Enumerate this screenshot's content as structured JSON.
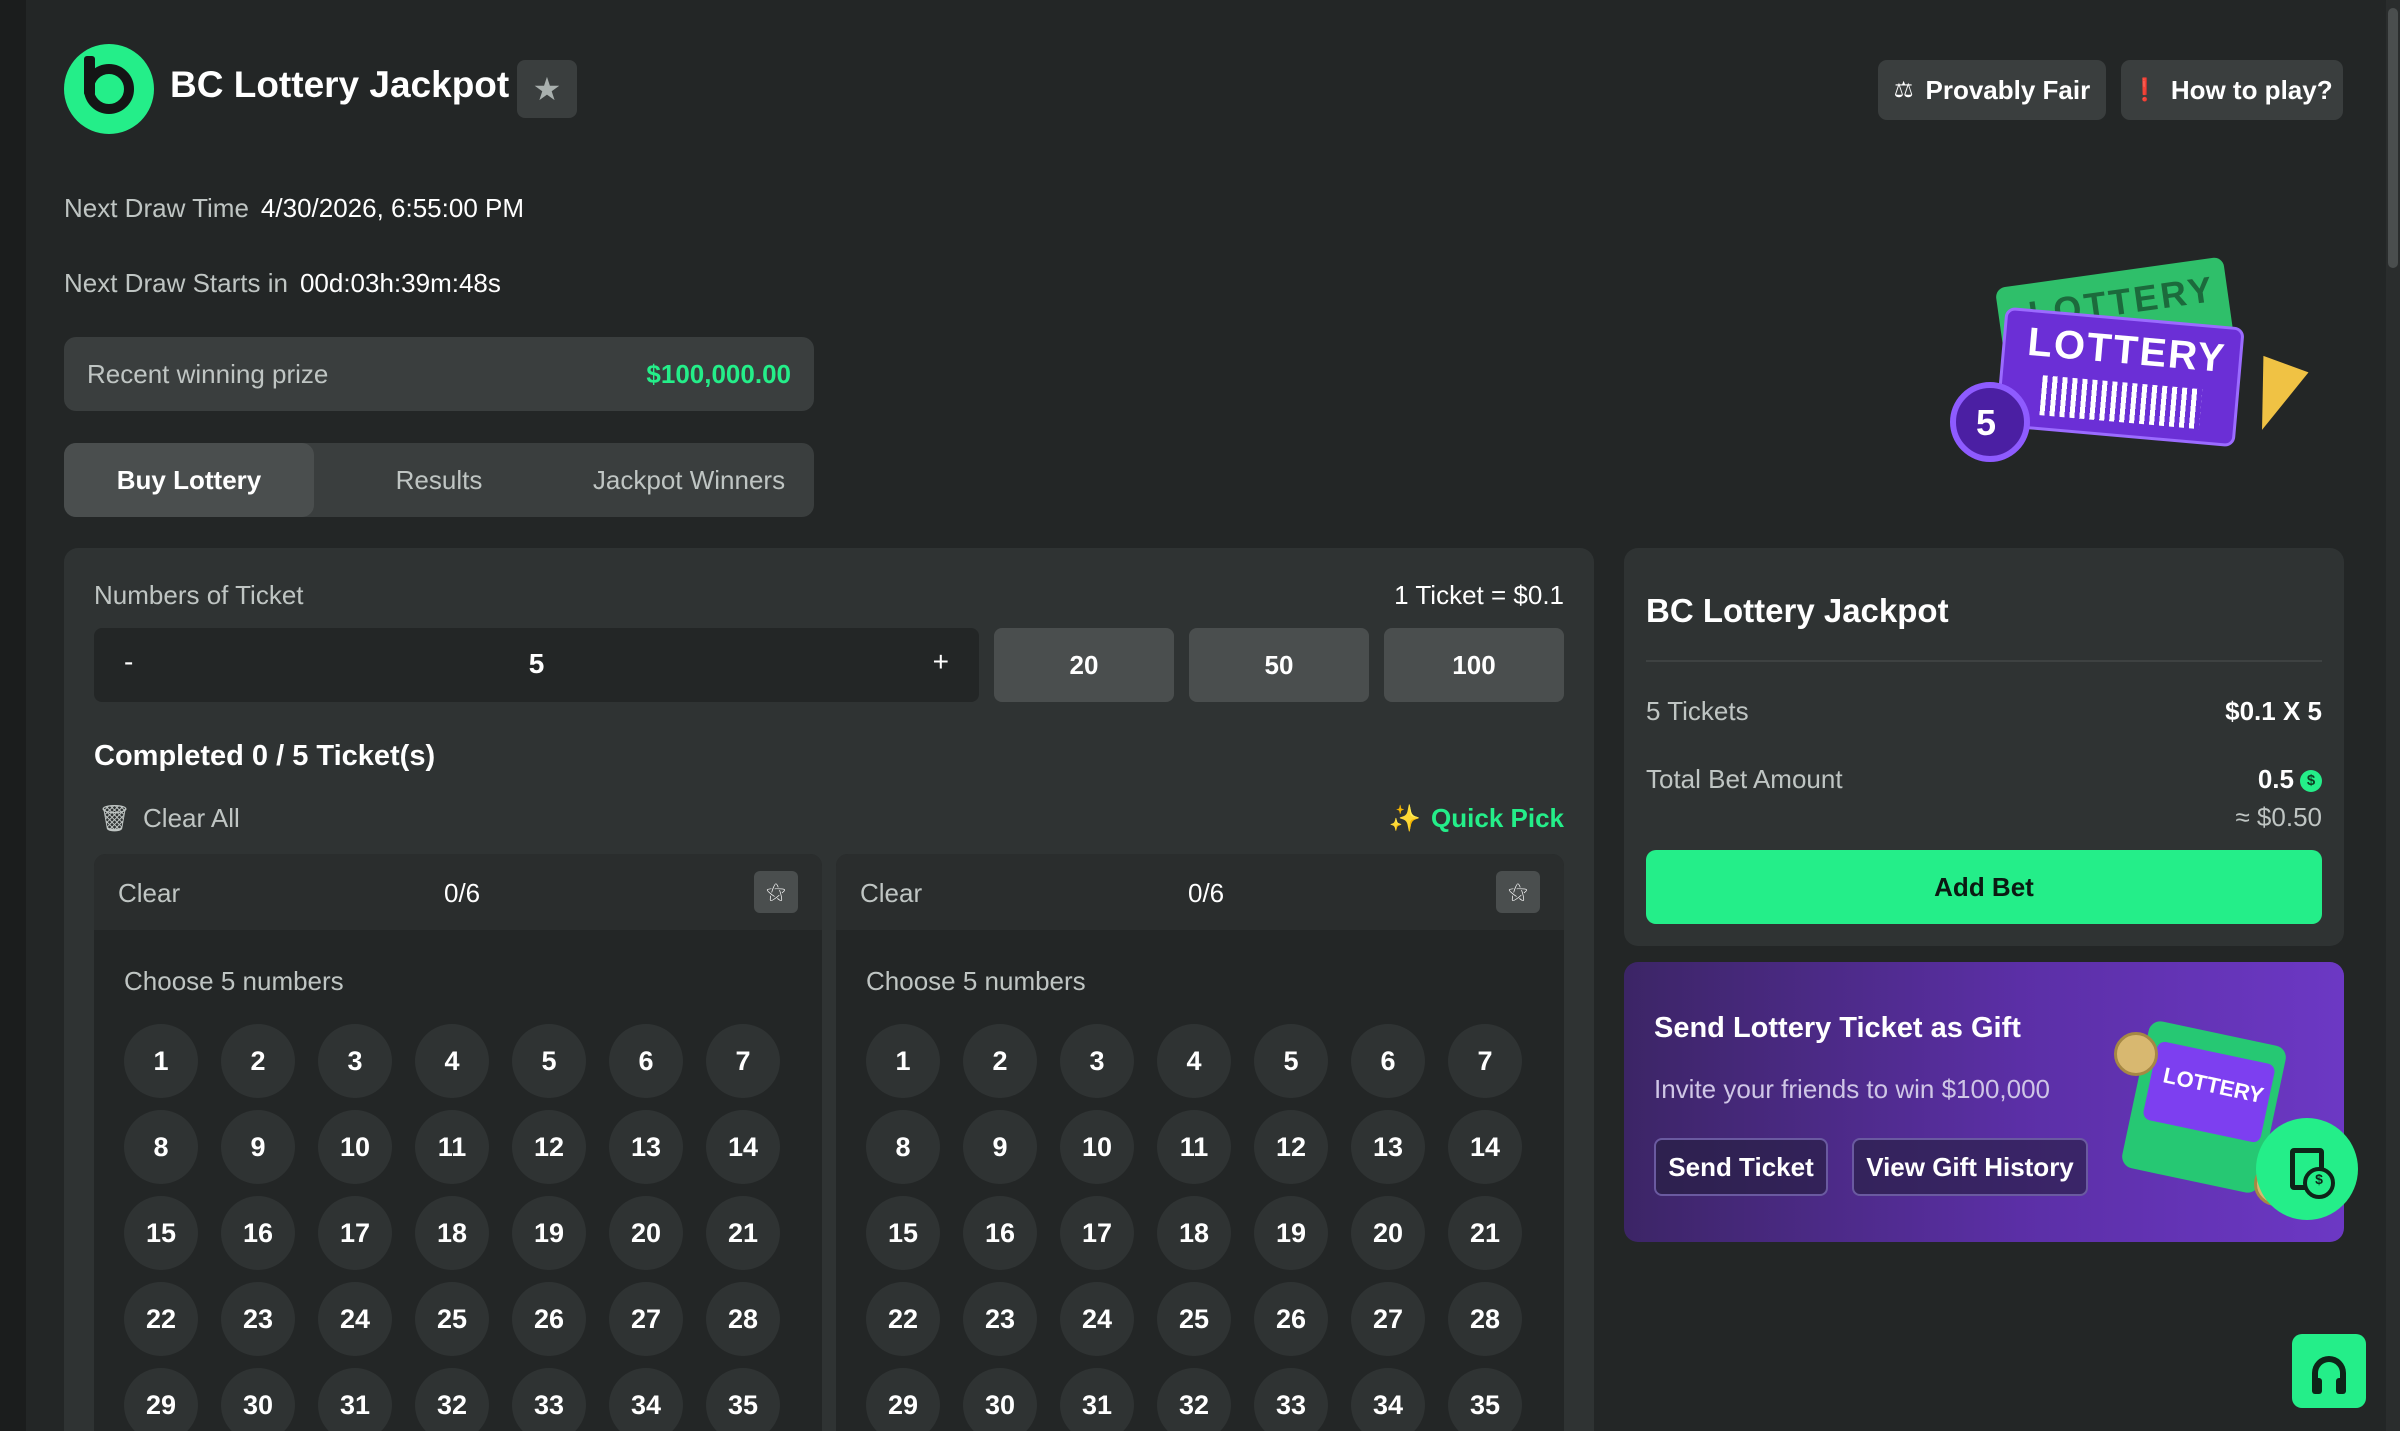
{
  "header": {
    "title": "BC Lottery Jackpot",
    "provably_fair": "Provably Fair",
    "how_to_play": "How to play?"
  },
  "draw": {
    "next_draw_time_label": "Next Draw Time",
    "next_draw_time": "4/30/2026, 6:55:00 PM",
    "starts_in_label": "Next Draw Starts in",
    "starts_in": "00d:03h:39m:48s"
  },
  "prize": {
    "label": "Recent winning prize",
    "amount": "$100,000.00"
  },
  "tabs": [
    {
      "label": "Buy Lottery",
      "active": true
    },
    {
      "label": "Results",
      "active": false
    },
    {
      "label": "Jackpot Winners",
      "active": false
    }
  ],
  "art": {
    "back_text": "LOTTERY",
    "front_text": "LOTTERY",
    "ball_number": "5"
  },
  "buy": {
    "tickets_label": "Numbers of Ticket",
    "price_note": "1 Ticket = $0.1",
    "minus": "-",
    "plus": "+",
    "ticket_count": "5",
    "quick_amounts": [
      "20",
      "50",
      "100"
    ],
    "completed": "Completed 0 / 5 Ticket(s)",
    "clear_all": "Clear All",
    "quick_pick": "Quick Pick"
  },
  "cards": [
    {
      "clear": "Clear",
      "count": "0/6",
      "choose": "Choose 5 numbers"
    },
    {
      "clear": "Clear",
      "count": "0/6",
      "choose": "Choose 5 numbers"
    }
  ],
  "numbers": [
    "1",
    "2",
    "3",
    "4",
    "5",
    "6",
    "7",
    "8",
    "9",
    "10",
    "11",
    "12",
    "13",
    "14",
    "15",
    "16",
    "17",
    "18",
    "19",
    "20",
    "21",
    "22",
    "23",
    "24",
    "25",
    "26",
    "27",
    "28",
    "29",
    "30",
    "31",
    "32",
    "33",
    "34",
    "35"
  ],
  "summary": {
    "title": "BC Lottery Jackpot",
    "tickets_label": "5 Tickets",
    "tickets_value": "$0.1 X 5",
    "total_label": "Total Bet Amount",
    "total_value": "0.5",
    "approx": "≈ $0.50",
    "add_bet": "Add Bet"
  },
  "gift": {
    "title": "Send Lottery Ticket as Gift",
    "subtitle": "Invite your friends to win $100,000",
    "send_ticket": "Send Ticket",
    "view_history": "View Gift History",
    "card_text": "LOTTERY"
  },
  "colors": {
    "accent": "#24ee89",
    "background": "#232626",
    "panel": "#2f3333",
    "gift_purple": "#5b2fa6"
  }
}
